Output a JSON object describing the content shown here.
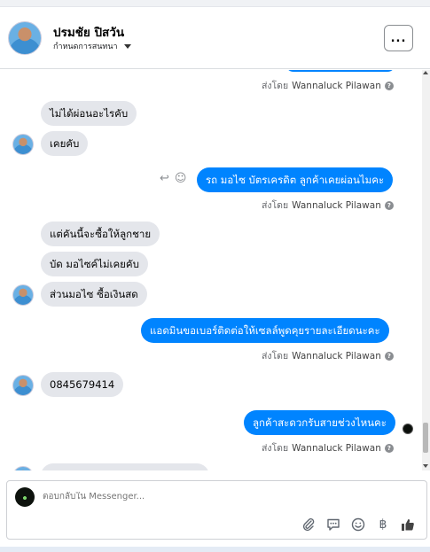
{
  "header": {
    "name": "ปรมชัย ปิสวัน",
    "subtitle": "กำหนดการสนทนา",
    "more_label": "..."
  },
  "sender": {
    "prefix": "ส่งโดย",
    "name": "Wannaluck Pilawan",
    "help": "?"
  },
  "messages": {
    "m1": "ไม่ได้ผ่อนอะไรคับ",
    "m2": "เคยคับ",
    "m3": "รถ มอไซ บัตรเครดิต ลูกค้าเคยผ่อนไมคะ",
    "m4": "แต่คันนี้จะซื้อให้ลูกชาย",
    "m5": "บัด มอไซค์ไม่เคยคับ",
    "m6": "ส่วนมอไซ ซื้อเงินสด",
    "m7": "แอดมินขอเบอร์ติดต่อให้เซลล์พูดคุยรายละเอียดนะคะ",
    "m8": "0845679414",
    "m9": "ลูกค้าสะดวกรับสายช่วงไหนคะ"
  },
  "message_actions": {
    "reply_icon": "↩",
    "react_icon": "☺"
  },
  "composer": {
    "placeholder": "ตอบกลับใน Messenger..."
  },
  "tools": {
    "attach": "attach-icon",
    "saved_reply": "saved-reply-icon",
    "emoji": "emoji-icon",
    "payment": "฿",
    "like": "like-icon"
  },
  "colors": {
    "outgoing_bubble": "#0084ff",
    "incoming_bubble": "#e4e6eb"
  }
}
